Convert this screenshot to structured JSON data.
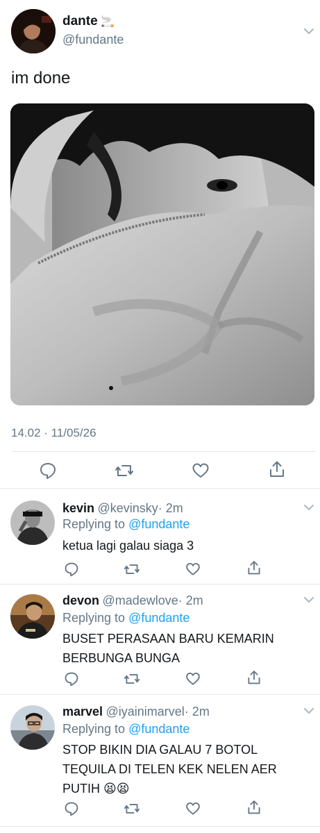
{
  "tweet": {
    "name": "dante",
    "name_emoji": "🚬",
    "handle": "@fundante",
    "text": "im done",
    "timestamp": "14.02 · 11/05/26"
  },
  "replies": [
    {
      "name": "kevin",
      "handle": "@kevinsky",
      "age": "· 2m",
      "replying_prefix": "Replying to ",
      "replying_to": "@fundante",
      "text_lines": [
        "ketua lagi galau siaga 3"
      ]
    },
    {
      "name": "devon",
      "handle": "@madewlove",
      "age": "· 2m",
      "replying_prefix": "Replying to ",
      "replying_to": "@fundante",
      "text_lines": [
        "BUSET PERASAAN BARU KEMARIN",
        "BERBUNGA BUNGA"
      ]
    },
    {
      "name": "marvel",
      "handle": "@iyainimarvel",
      "age": "· 2m",
      "replying_prefix": "Replying to ",
      "replying_to": "@fundante",
      "text_lines": [
        "STOP BIKIN DIA GALAU 7 BOTOL",
        "TEQUILA DI TELEN KEK NELEN AER",
        "PUTIH 😫😫"
      ]
    }
  ],
  "icons": {
    "reply": "reply-icon",
    "retweet": "retweet-icon",
    "like": "heart-icon",
    "share": "share-icon",
    "more": "chevron-down-icon"
  },
  "colors": {
    "text": "#14171a",
    "secondary": "#657786",
    "link": "#1da1f2",
    "divider": "#e1e8ed",
    "chevron": "#aab8c2"
  }
}
